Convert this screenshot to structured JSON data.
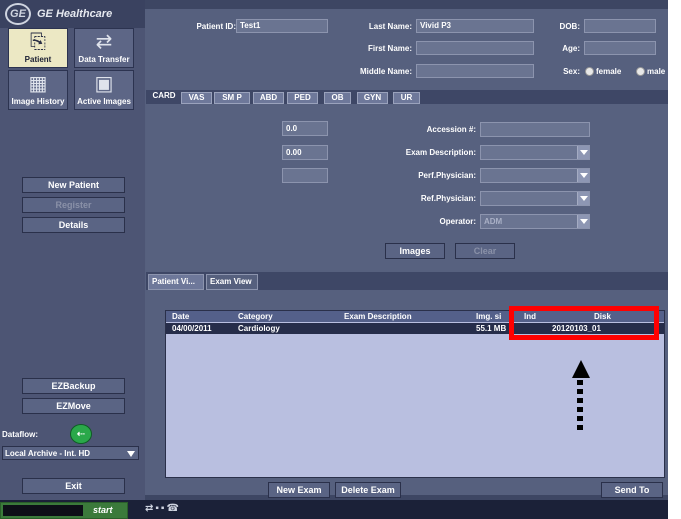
{
  "brand": {
    "logo_mark": "GE",
    "name": "GE Healthcare"
  },
  "nav": [
    {
      "label": "Patient",
      "icon": "patient-icon",
      "glyph": "⎘",
      "active": true
    },
    {
      "label": "Data Transfer",
      "icon": "data-transfer-icon",
      "glyph": "⇄",
      "active": false
    },
    {
      "label": "Image History",
      "icon": "image-history-icon",
      "glyph": "▦",
      "active": false
    },
    {
      "label": "Active Images",
      "icon": "active-images-icon",
      "glyph": "▣",
      "active": false
    }
  ],
  "sidebar": {
    "new_patient": "New Patient",
    "register": "Register",
    "details": "Details",
    "ezbackup": "EZBackup",
    "ezmove": "EZMove",
    "dataflow_label": "Dataflow:",
    "dataflow_value": "Local Archive - Int. HD",
    "exit": "Exit"
  },
  "patient": {
    "id_label": "Patient ID:",
    "id_value": "Test1",
    "last_name_label": "Last Name:",
    "last_name_value": "Vivid P3",
    "first_name_label": "First Name:",
    "first_name_value": "",
    "middle_name_label": "Middle Name:",
    "middle_name_value": "",
    "dob_label": "DOB:",
    "dob_value": "",
    "age_label": "Age:",
    "age_value": "",
    "sex_label": "Sex:",
    "sex_female": "female",
    "sex_male": "male"
  },
  "exam_tabs": [
    "CARD",
    "VAS",
    "SM P",
    "ABD",
    "PED",
    "OB",
    "GYN",
    "UR"
  ],
  "exam": {
    "value_1": "0.0",
    "value_2": "0.00",
    "value_3": "",
    "accession_label": "Accession #:",
    "accession_value": "",
    "exam_desc_label": "Exam Description:",
    "exam_desc_value": "",
    "perf_physician_label": "Perf.Physician:",
    "perf_physician_value": "",
    "ref_physician_label": "Ref.Physician:",
    "ref_physician_value": "",
    "operator_label": "Operator:",
    "operator_value": "ADM",
    "images_button": "Images",
    "clear_button": "Clear"
  },
  "view_tabs": [
    "Patient Vi...",
    "Exam View"
  ],
  "exam_list": {
    "columns": [
      "Date",
      "Category",
      "Exam Description",
      "Img. si",
      "Ind",
      "Disk"
    ],
    "rows": [
      {
        "date": "04/00/2011",
        "category": "Cardiology",
        "description": "",
        "img_size": "55.1 MB",
        "ind": "",
        "disk": "20120103_01"
      }
    ]
  },
  "actions": {
    "new_exam": "New Exam",
    "delete_exam": "Delete Exam",
    "send_to": "Send To"
  },
  "taskbar": {
    "start": "start"
  },
  "colors": {
    "highlight": "#ff0000",
    "background": "#56607e",
    "list_bg": "#b9bfe0"
  }
}
